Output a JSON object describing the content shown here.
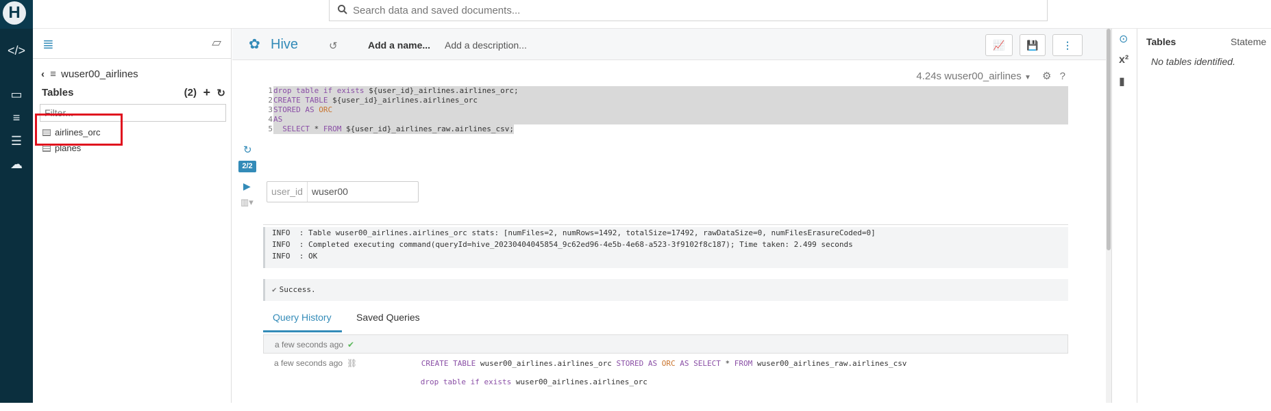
{
  "search": {
    "placeholder": "Search data and saved documents..."
  },
  "left": {
    "database": "wuser00_airlines",
    "tables_label": "Tables",
    "tables_count": "(2)",
    "filter_placeholder": "Filter...",
    "tables": [
      "airlines_orc",
      "planes"
    ]
  },
  "editor": {
    "app_title": "Hive",
    "name_placeholder": "Add a name...",
    "description_placeholder": "Add a description...",
    "exec_time": "4.24s",
    "exec_database": "wuser00_airlines",
    "help": "?",
    "statement_badge": "2/2",
    "code_lines": [
      "drop table if exists ${user_id}_airlines.airlines_orc;",
      "CREATE TABLE ${user_id}_airlines.airlines_orc",
      "STORED AS ORC",
      "AS",
      "  SELECT * FROM ${user_id}_airlines_raw.airlines_csv;"
    ],
    "param_label": "user_id",
    "param_value": "wuser00",
    "log_lines": [
      "INFO  : Table wuser00_airlines.airlines_orc stats: [numFiles=2, numRows=1492, totalSize=17492, rawDataSize=0, numFilesErasureCoded=0]",
      "INFO  : Completed executing command(queryId=hive_20230404045854_9c62ed96-4e5b-4e68-a523-3f9102f8c187); Time taken: 2.499 seconds",
      "INFO  : OK"
    ],
    "success": "Success."
  },
  "history": {
    "tabs": [
      "Query History",
      "Saved Queries"
    ],
    "rows": [
      {
        "time": "a few seconds ago",
        "query": "CREATE TABLE wuser00_airlines.airlines_orc STORED AS ORC AS SELECT * FROM wuser00_airlines_raw.airlines_csv"
      },
      {
        "time": "a few seconds ago",
        "query": "drop table if exists wuser00_airlines.airlines_orc"
      }
    ]
  },
  "right": {
    "tab_tables": "Tables",
    "tab_statements": "Stateme",
    "empty": "No tables identified."
  }
}
